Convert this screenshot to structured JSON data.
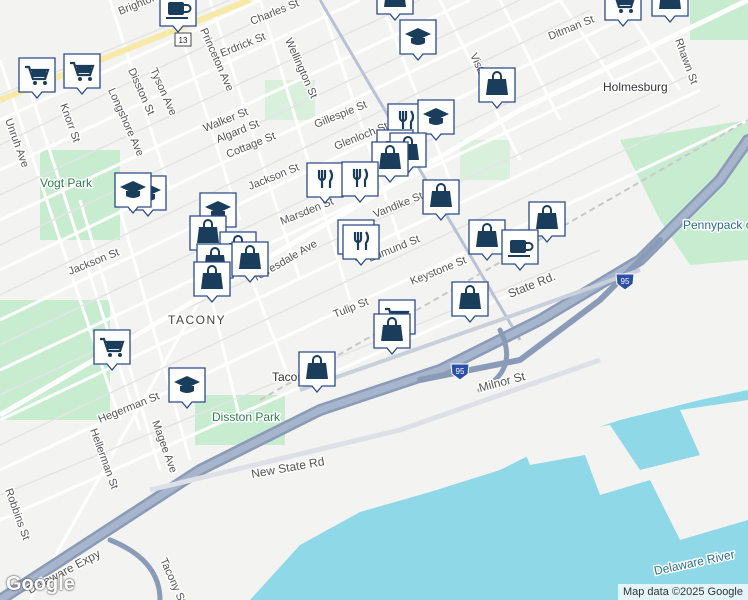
{
  "map": {
    "attribution": "Map data ©2025 Google",
    "logo": "Google",
    "neighborhood": "TACONY",
    "parks": [
      "Vogt Park",
      "Disston Park"
    ],
    "places": [
      "Holmesburg",
      "Tacony"
    ],
    "water_labels": [
      "Pennypack on the Delaware",
      "Delaware River"
    ],
    "major_roads": [
      "Delaware Expy",
      "New State Rd",
      "State Rd.",
      "Milnor St"
    ],
    "highway_shields": [
      "95",
      "95",
      "13"
    ],
    "streets": [
      "Brighton St",
      "Charles St",
      "Princeton Ave",
      "Erdrick St",
      "Wellington St",
      "Tyson Ave",
      "Disston St",
      "Longshore Ave",
      "Walker St",
      "Cottage St",
      "Algard St",
      "Jackson St",
      "Gillespie St",
      "Glenloch St",
      "Unruh Ave",
      "Knorr St",
      "Marsden St",
      "Torresdale Ave",
      "Vandike St",
      "Edmund St",
      "Tulip St",
      "Keystone St",
      "Vista St",
      "Rhawn St",
      "Ditman St",
      "Hegerman St",
      "Hellerman St",
      "Magee Ave",
      "Robbins St",
      "Jackson St",
      "Tacony St"
    ],
    "pins": [
      {
        "icon": "cafe-icon",
        "label": "Coffee shop"
      },
      {
        "icon": "grocery-cart-icon",
        "label": "Grocery"
      },
      {
        "icon": "education-icon",
        "label": "School"
      },
      {
        "icon": "shopping-bag-icon",
        "label": "Store"
      },
      {
        "icon": "restaurant-icon",
        "label": "Restaurant"
      }
    ],
    "colors": {
      "water": "#8ed8e8",
      "park": "#c8ecd0",
      "highway": "#8a9bb8",
      "pin_fill": "#ffffff",
      "pin_icon": "#1a3d5c"
    }
  }
}
